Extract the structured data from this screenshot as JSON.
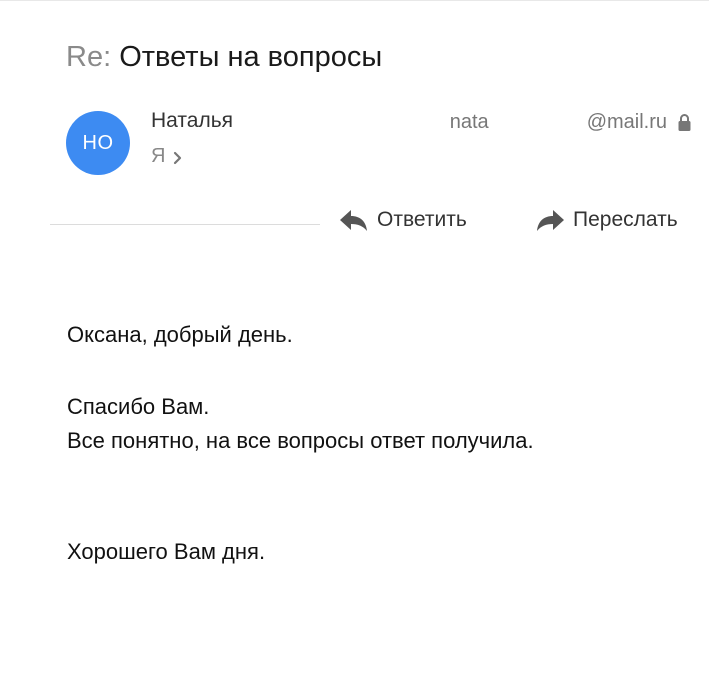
{
  "message": {
    "subject_prefix": "Re:",
    "subject": "Ответы на вопросы"
  },
  "sender": {
    "initials": "НО",
    "name": "Наталья",
    "email_local": "nata",
    "email_domain": "@mail.ru",
    "avatar_color": "#3d8bf2"
  },
  "recipient": {
    "label": "Я"
  },
  "actions": {
    "reply_label": "Ответить",
    "forward_label": "Переслать"
  },
  "body": {
    "greeting": "Оксана, добрый день.",
    "line1": "Спасибо Вам.",
    "line2": "Все понятно, на все вопросы ответ получила.",
    "closing": "Хорошего Вам дня."
  },
  "icons": [
    "lock-icon",
    "chevron-right-icon",
    "reply-icon",
    "forward-icon"
  ]
}
